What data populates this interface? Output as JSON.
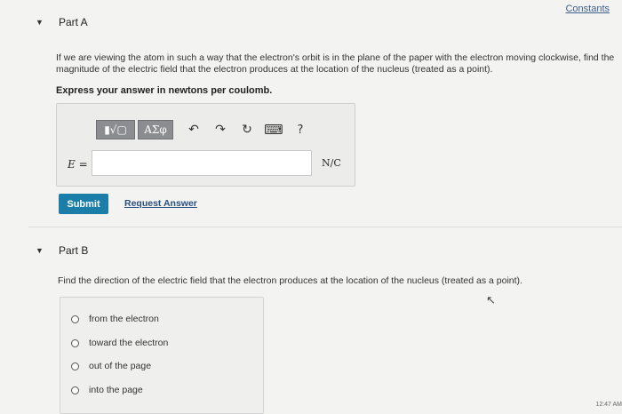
{
  "header": {
    "constants_link": "Constants"
  },
  "partA": {
    "title": "Part A",
    "question": "If we are viewing the atom in such a way that the electron's orbit is in the plane of the paper with the electron moving clockwise, find the magnitude of the electric field that the electron produces at the location of the nucleus (treated as a point).",
    "instruction": "Express your answer in newtons per coulomb.",
    "toolbar": {
      "templates_label": "▮√▢",
      "greek_label": "ΑΣφ",
      "undo_glyph": "↶",
      "redo_glyph": "↷",
      "reset_glyph": "↻",
      "keyboard_glyph": "⌨",
      "help_label": "?"
    },
    "answer_label": "E =",
    "answer_value": "",
    "unit": "N/C",
    "submit_label": "Submit",
    "request_label": "Request Answer"
  },
  "partB": {
    "title": "Part B",
    "question": "Find the direction of the electric field that the electron produces at the location of the nucleus (treated as a point).",
    "options": [
      {
        "label": "from the electron",
        "selected": false
      },
      {
        "label": "toward the electron",
        "selected": false
      },
      {
        "label": "out of the page",
        "selected": false
      },
      {
        "label": "into the page",
        "selected": false
      }
    ]
  },
  "clock_partial": "12:47 AM"
}
